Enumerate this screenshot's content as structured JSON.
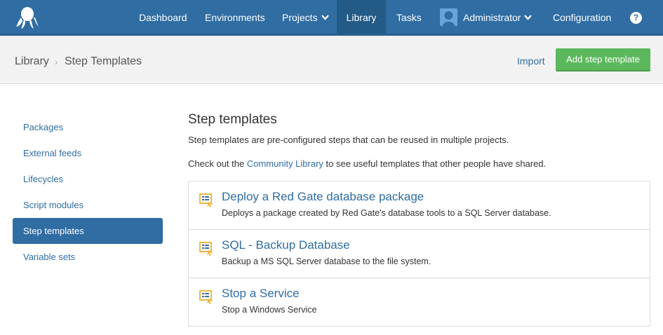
{
  "nav": {
    "items": [
      {
        "label": "Dashboard"
      },
      {
        "label": "Environments"
      },
      {
        "label": "Projects"
      },
      {
        "label": "Library"
      },
      {
        "label": "Tasks"
      },
      {
        "label": "Administrator"
      },
      {
        "label": "Configuration"
      }
    ],
    "active": "Library",
    "help_label": "?"
  },
  "breadcrumb": {
    "parent": "Library",
    "separator": "›",
    "current": "Step Templates"
  },
  "actions": {
    "import_label": "Import",
    "add_label": "Add step template"
  },
  "sidebar": {
    "items": [
      {
        "label": "Packages"
      },
      {
        "label": "External feeds"
      },
      {
        "label": "Lifecycles"
      },
      {
        "label": "Script modules"
      },
      {
        "label": "Step templates"
      },
      {
        "label": "Variable sets"
      }
    ],
    "active": "Step templates"
  },
  "main": {
    "title": "Step templates",
    "description": "Step templates are pre-configured steps that can be reused in multiple projects.",
    "community_prefix": "Check out the ",
    "community_link": "Community Library",
    "community_suffix": " to see useful templates that other people have shared."
  },
  "templates": [
    {
      "name": "Deploy a Red Gate database package",
      "description": "Deploys a package created by Red Gate's database tools to a SQL Server database.",
      "icon": "step-template-icon"
    },
    {
      "name": "SQL - Backup Database",
      "description": "Backup a MS SQL Server database to the file system.",
      "icon": "step-template-icon"
    },
    {
      "name": "Stop a Service",
      "description": "Stop a Windows Service",
      "icon": "step-template-icon"
    }
  ],
  "colors": {
    "nav_bg": "#2f6da3",
    "nav_active": "#245a86",
    "link": "#2f6da3",
    "primary_button": "#5cb85c"
  }
}
